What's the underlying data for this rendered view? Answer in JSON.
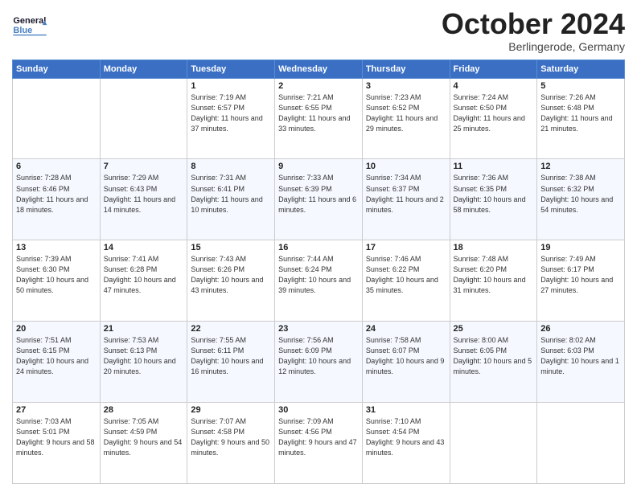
{
  "header": {
    "month_title": "October 2024",
    "location": "Berlingerode, Germany",
    "logo_line1": "General",
    "logo_line2": "Blue"
  },
  "days_of_week": [
    "Sunday",
    "Monday",
    "Tuesday",
    "Wednesday",
    "Thursday",
    "Friday",
    "Saturday"
  ],
  "weeks": [
    [
      {
        "day": "",
        "sunrise": "",
        "sunset": "",
        "daylight": ""
      },
      {
        "day": "",
        "sunrise": "",
        "sunset": "",
        "daylight": ""
      },
      {
        "day": "1",
        "sunrise": "Sunrise: 7:19 AM",
        "sunset": "Sunset: 6:57 PM",
        "daylight": "Daylight: 11 hours and 37 minutes."
      },
      {
        "day": "2",
        "sunrise": "Sunrise: 7:21 AM",
        "sunset": "Sunset: 6:55 PM",
        "daylight": "Daylight: 11 hours and 33 minutes."
      },
      {
        "day": "3",
        "sunrise": "Sunrise: 7:23 AM",
        "sunset": "Sunset: 6:52 PM",
        "daylight": "Daylight: 11 hours and 29 minutes."
      },
      {
        "day": "4",
        "sunrise": "Sunrise: 7:24 AM",
        "sunset": "Sunset: 6:50 PM",
        "daylight": "Daylight: 11 hours and 25 minutes."
      },
      {
        "day": "5",
        "sunrise": "Sunrise: 7:26 AM",
        "sunset": "Sunset: 6:48 PM",
        "daylight": "Daylight: 11 hours and 21 minutes."
      }
    ],
    [
      {
        "day": "6",
        "sunrise": "Sunrise: 7:28 AM",
        "sunset": "Sunset: 6:46 PM",
        "daylight": "Daylight: 11 hours and 18 minutes."
      },
      {
        "day": "7",
        "sunrise": "Sunrise: 7:29 AM",
        "sunset": "Sunset: 6:43 PM",
        "daylight": "Daylight: 11 hours and 14 minutes."
      },
      {
        "day": "8",
        "sunrise": "Sunrise: 7:31 AM",
        "sunset": "Sunset: 6:41 PM",
        "daylight": "Daylight: 11 hours and 10 minutes."
      },
      {
        "day": "9",
        "sunrise": "Sunrise: 7:33 AM",
        "sunset": "Sunset: 6:39 PM",
        "daylight": "Daylight: 11 hours and 6 minutes."
      },
      {
        "day": "10",
        "sunrise": "Sunrise: 7:34 AM",
        "sunset": "Sunset: 6:37 PM",
        "daylight": "Daylight: 11 hours and 2 minutes."
      },
      {
        "day": "11",
        "sunrise": "Sunrise: 7:36 AM",
        "sunset": "Sunset: 6:35 PM",
        "daylight": "Daylight: 10 hours and 58 minutes."
      },
      {
        "day": "12",
        "sunrise": "Sunrise: 7:38 AM",
        "sunset": "Sunset: 6:32 PM",
        "daylight": "Daylight: 10 hours and 54 minutes."
      }
    ],
    [
      {
        "day": "13",
        "sunrise": "Sunrise: 7:39 AM",
        "sunset": "Sunset: 6:30 PM",
        "daylight": "Daylight: 10 hours and 50 minutes."
      },
      {
        "day": "14",
        "sunrise": "Sunrise: 7:41 AM",
        "sunset": "Sunset: 6:28 PM",
        "daylight": "Daylight: 10 hours and 47 minutes."
      },
      {
        "day": "15",
        "sunrise": "Sunrise: 7:43 AM",
        "sunset": "Sunset: 6:26 PM",
        "daylight": "Daylight: 10 hours and 43 minutes."
      },
      {
        "day": "16",
        "sunrise": "Sunrise: 7:44 AM",
        "sunset": "Sunset: 6:24 PM",
        "daylight": "Daylight: 10 hours and 39 minutes."
      },
      {
        "day": "17",
        "sunrise": "Sunrise: 7:46 AM",
        "sunset": "Sunset: 6:22 PM",
        "daylight": "Daylight: 10 hours and 35 minutes."
      },
      {
        "day": "18",
        "sunrise": "Sunrise: 7:48 AM",
        "sunset": "Sunset: 6:20 PM",
        "daylight": "Daylight: 10 hours and 31 minutes."
      },
      {
        "day": "19",
        "sunrise": "Sunrise: 7:49 AM",
        "sunset": "Sunset: 6:17 PM",
        "daylight": "Daylight: 10 hours and 27 minutes."
      }
    ],
    [
      {
        "day": "20",
        "sunrise": "Sunrise: 7:51 AM",
        "sunset": "Sunset: 6:15 PM",
        "daylight": "Daylight: 10 hours and 24 minutes."
      },
      {
        "day": "21",
        "sunrise": "Sunrise: 7:53 AM",
        "sunset": "Sunset: 6:13 PM",
        "daylight": "Daylight: 10 hours and 20 minutes."
      },
      {
        "day": "22",
        "sunrise": "Sunrise: 7:55 AM",
        "sunset": "Sunset: 6:11 PM",
        "daylight": "Daylight: 10 hours and 16 minutes."
      },
      {
        "day": "23",
        "sunrise": "Sunrise: 7:56 AM",
        "sunset": "Sunset: 6:09 PM",
        "daylight": "Daylight: 10 hours and 12 minutes."
      },
      {
        "day": "24",
        "sunrise": "Sunrise: 7:58 AM",
        "sunset": "Sunset: 6:07 PM",
        "daylight": "Daylight: 10 hours and 9 minutes."
      },
      {
        "day": "25",
        "sunrise": "Sunrise: 8:00 AM",
        "sunset": "Sunset: 6:05 PM",
        "daylight": "Daylight: 10 hours and 5 minutes."
      },
      {
        "day": "26",
        "sunrise": "Sunrise: 8:02 AM",
        "sunset": "Sunset: 6:03 PM",
        "daylight": "Daylight: 10 hours and 1 minute."
      }
    ],
    [
      {
        "day": "27",
        "sunrise": "Sunrise: 7:03 AM",
        "sunset": "Sunset: 5:01 PM",
        "daylight": "Daylight: 9 hours and 58 minutes."
      },
      {
        "day": "28",
        "sunrise": "Sunrise: 7:05 AM",
        "sunset": "Sunset: 4:59 PM",
        "daylight": "Daylight: 9 hours and 54 minutes."
      },
      {
        "day": "29",
        "sunrise": "Sunrise: 7:07 AM",
        "sunset": "Sunset: 4:58 PM",
        "daylight": "Daylight: 9 hours and 50 minutes."
      },
      {
        "day": "30",
        "sunrise": "Sunrise: 7:09 AM",
        "sunset": "Sunset: 4:56 PM",
        "daylight": "Daylight: 9 hours and 47 minutes."
      },
      {
        "day": "31",
        "sunrise": "Sunrise: 7:10 AM",
        "sunset": "Sunset: 4:54 PM",
        "daylight": "Daylight: 9 hours and 43 minutes."
      },
      {
        "day": "",
        "sunrise": "",
        "sunset": "",
        "daylight": ""
      },
      {
        "day": "",
        "sunrise": "",
        "sunset": "",
        "daylight": ""
      }
    ]
  ]
}
